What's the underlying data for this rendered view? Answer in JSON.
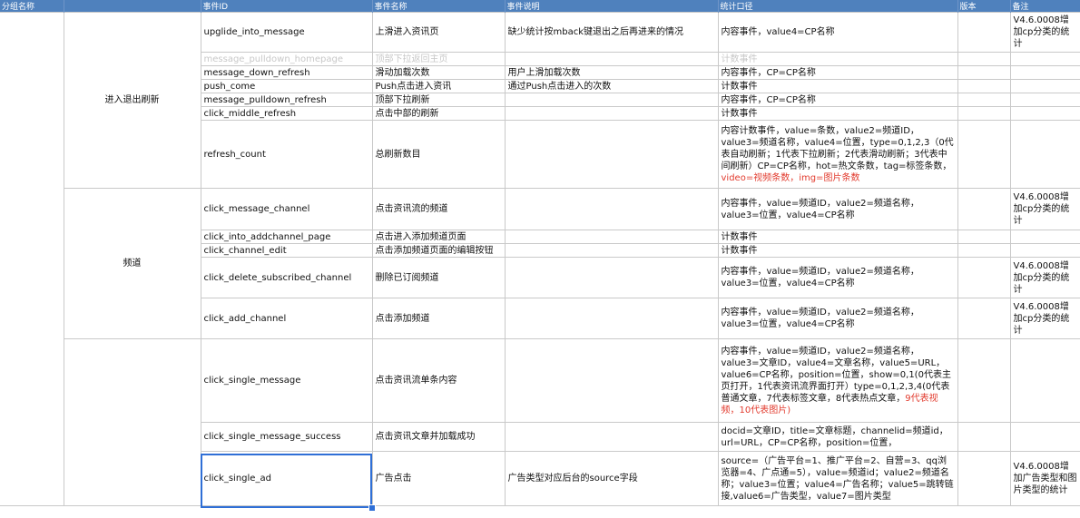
{
  "headers": [
    "分组名称",
    "事件ID",
    "事件名称",
    "事件说明",
    "统计口径",
    "版本",
    "备注"
  ],
  "groups": [
    "进入退出刷新",
    "频道"
  ],
  "rows": [
    {
      "id": "upglide_into_message",
      "name": "上滑进入资讯页",
      "desc": "缺少统计按mback键退出之后再进来的情况",
      "stat": "内容事件，value4=CP名称",
      "ver": "",
      "note": "V4.6.0008增加cp分类的统计"
    },
    {
      "id": "message_pulldown_homepage",
      "name": "顶部下拉返回主页",
      "desc": "",
      "stat": "计数事件",
      "ver": "",
      "note": ""
    },
    {
      "id": "message_down_refresh",
      "name": "滑动加载次数",
      "desc": "用户上滑加载次数",
      "stat": "内容事件，CP=CP名称",
      "ver": "",
      "note": ""
    },
    {
      "id": "push_come",
      "name": "Push点击进入资讯",
      "desc": "通过Push点击进入的次数",
      "stat": "计数事件",
      "ver": "",
      "note": ""
    },
    {
      "id": "message_pulldown_refresh",
      "name": "顶部下拉刷新",
      "desc": "",
      "stat": "内容事件，CP=CP名称",
      "ver": "",
      "note": ""
    },
    {
      "id": "click_middle_refresh",
      "name": "点击中部的刷新",
      "desc": "",
      "stat": "计数事件",
      "ver": "",
      "note": ""
    },
    {
      "id": "refresh_count",
      "name": "总刷新数目",
      "desc": "",
      "stat": "内容计数事件，value=条数，value2=频道ID，value3=频道名称，value4=位置，type=0,1,2,3（0代表自动刷新；1代表下拉刷新；2代表滑动刷新；3代表中间刷新）CP=CP名称，hot=热文条数，tag=标签条数，",
      "stat_red": "video=视频条数，img=图片条数",
      "ver": "",
      "note": ""
    },
    {
      "id": "click_message_channel",
      "name": "点击资讯流的频道",
      "desc": "",
      "stat": "内容事件，value=频道ID，value2=频道名称，value3=位置，value4=CP名称",
      "ver": "",
      "note": "V4.6.0008增加cp分类的统计"
    },
    {
      "id": "click_into_addchannel_page",
      "name": "点击进入添加频道页面",
      "desc": "",
      "stat": "计数事件",
      "ver": "",
      "note": ""
    },
    {
      "id": "click_channel_edit",
      "name": "点击添加频道页面的编辑按钮",
      "desc": "",
      "stat": "计数事件",
      "ver": "",
      "note": ""
    },
    {
      "id": "click_delete_subscribed_channel",
      "name": "删除已订阅频道",
      "desc": "",
      "stat": "内容事件，value=频道ID，value2=频道名称，value3=位置，value4=CP名称",
      "ver": "",
      "note": "V4.6.0008增加cp分类的统计"
    },
    {
      "id": "click_add_channel",
      "name": "点击添加频道",
      "desc": "",
      "stat": "内容事件，value=频道ID，value2=频道名称，value3=位置，value4=CP名称",
      "ver": "",
      "note": "V4.6.0008增加cp分类的统计"
    },
    {
      "id": "click_single_message",
      "name": "点击资讯流单条内容",
      "desc": "",
      "stat": "内容事件，value=频道ID，value2=频道名称，value3=文章ID，value4=文章名称，value5=URL，value6=CP名称，position=位置，show=0,1(0代表主页打开，1代表资讯流界面打开）type=0,1,2,3,4(0代表普通文章，7代表标签文章，8代表热点文章，",
      "stat_red": "9代表视频，10代表图片)",
      "ver": "",
      "note": ""
    },
    {
      "id": "click_single_message_success",
      "name": "点击资讯文章并加载成功",
      "desc": "",
      "stat": "docid=文章ID，title=文章标题，channelid=频道id，url=URL，CP=CP名称，position=位置，",
      "ver": "",
      "note": ""
    },
    {
      "id": "click_single_ad",
      "name": "广告点击",
      "desc": "广告类型对应后台的source字段",
      "stat": "source=（广告平台=1、推广平台=2、自营=3、qq浏览器=4、广点通=5），value=频道id；value2=频道名称；value3=位置；value4=广告名称；value5=跳转链接,value6=广告类型，value7=图片类型",
      "ver": "",
      "note": "V4.6.0008增加广告类型和图片类型的统计"
    }
  ]
}
